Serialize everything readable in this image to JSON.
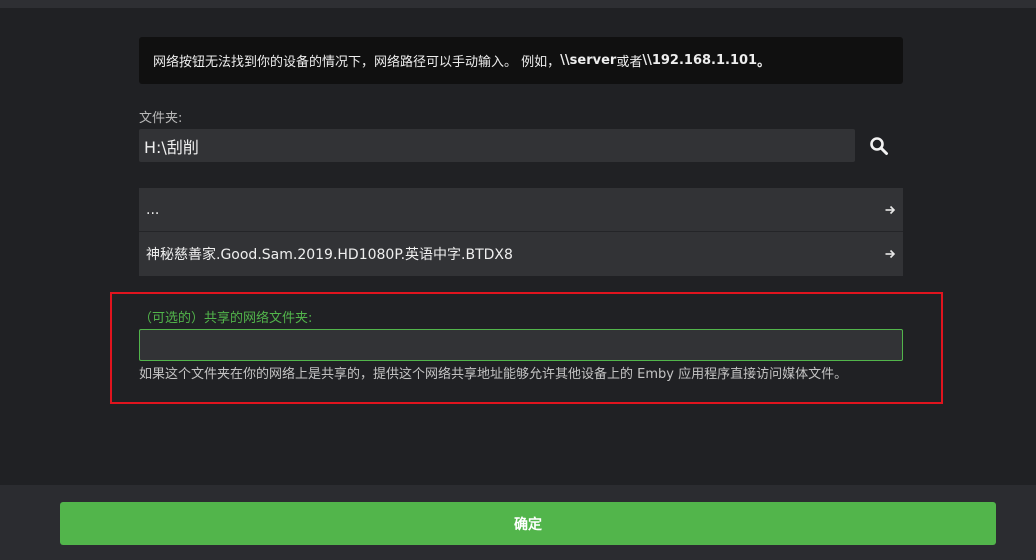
{
  "info": {
    "text_prefix": "网络按钮无法找到你的设备的情况下，网络路径可以手动输入。 例如，",
    "example1": "\\\\server",
    "text_mid": " 或者 ",
    "example2": "\\\\192.168.1.101",
    "text_suffix": "。"
  },
  "folder": {
    "label": "文件夹:",
    "value": "H:\\刮削",
    "search_icon": "search-icon"
  },
  "directory_list": {
    "items": [
      {
        "label": "...",
        "icon": "arrow-right-icon"
      },
      {
        "label": "神秘慈善家.Good.Sam.2019.HD1080P.英语中字.BTDX8",
        "icon": "arrow-right-icon"
      }
    ]
  },
  "network_share": {
    "label": "（可选的）共享的网络文件夹:",
    "value": "",
    "help": "如果这个文件夹在你的网络上是共享的，提供这个网络共享地址能够允许其他设备上的 Emby 应用程序直接访问媒体文件。",
    "highlight_color": "#e0141e"
  },
  "footer": {
    "ok_label": "确定"
  },
  "colors": {
    "accent": "#52b54b",
    "background": "#202124",
    "input_bg": "#323336"
  }
}
